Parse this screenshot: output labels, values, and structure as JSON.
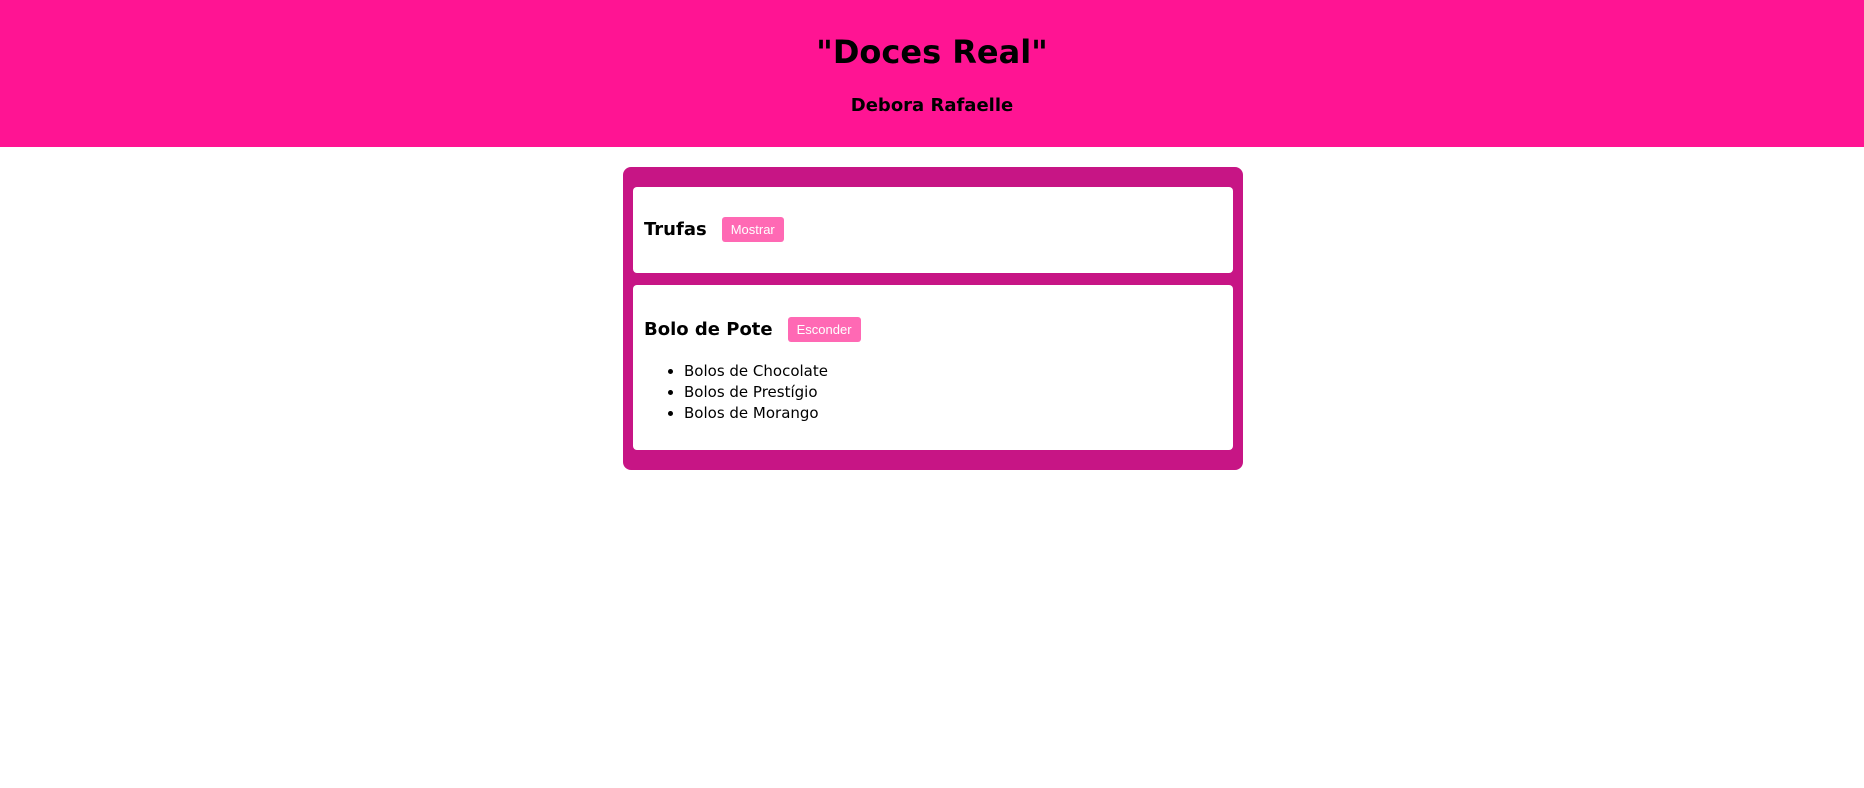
{
  "header": {
    "title": "\"Doces Real\"",
    "subtitle": "Debora Rafaelle"
  },
  "sections": [
    {
      "title": "Trufas",
      "button_label": "Mostrar",
      "items": []
    },
    {
      "title": "Bolo de Pote",
      "button_label": "Esconder",
      "items": [
        "Bolos de Chocolate",
        "Bolos de Prestígio",
        "Bolos de Morango"
      ]
    }
  ],
  "colors": {
    "header_bg": "#ff1493",
    "container_bg": "#c71585",
    "button_bg": "#ff69b4"
  }
}
